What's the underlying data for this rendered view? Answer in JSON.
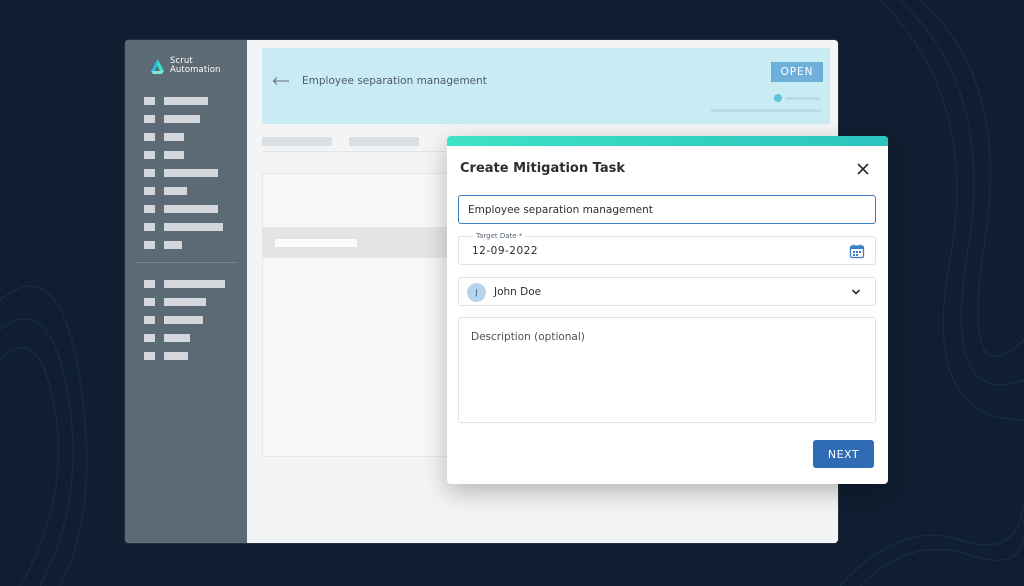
{
  "app": {
    "logo_line1": "Scrut",
    "logo_line2": "Automation",
    "brand_color": "#3ee2c5"
  },
  "sidebar": {
    "icons": [
      "placeholder-nav-icon"
    ]
  },
  "header": {
    "title": "Employee separation management",
    "status_badge": "OPEN",
    "accent_color": "#c9ebf3"
  },
  "modal": {
    "title": "Create Mitigation Task",
    "task_name_value": "Employee separation management",
    "target_date_label": "Target Date *",
    "target_date_value": "12-09-2022",
    "assignee_initial": "J",
    "assignee_name": "John Doe",
    "description_placeholder": "Description (optional)",
    "next_label": "NEXT",
    "primary_color": "#2f6cb5"
  }
}
